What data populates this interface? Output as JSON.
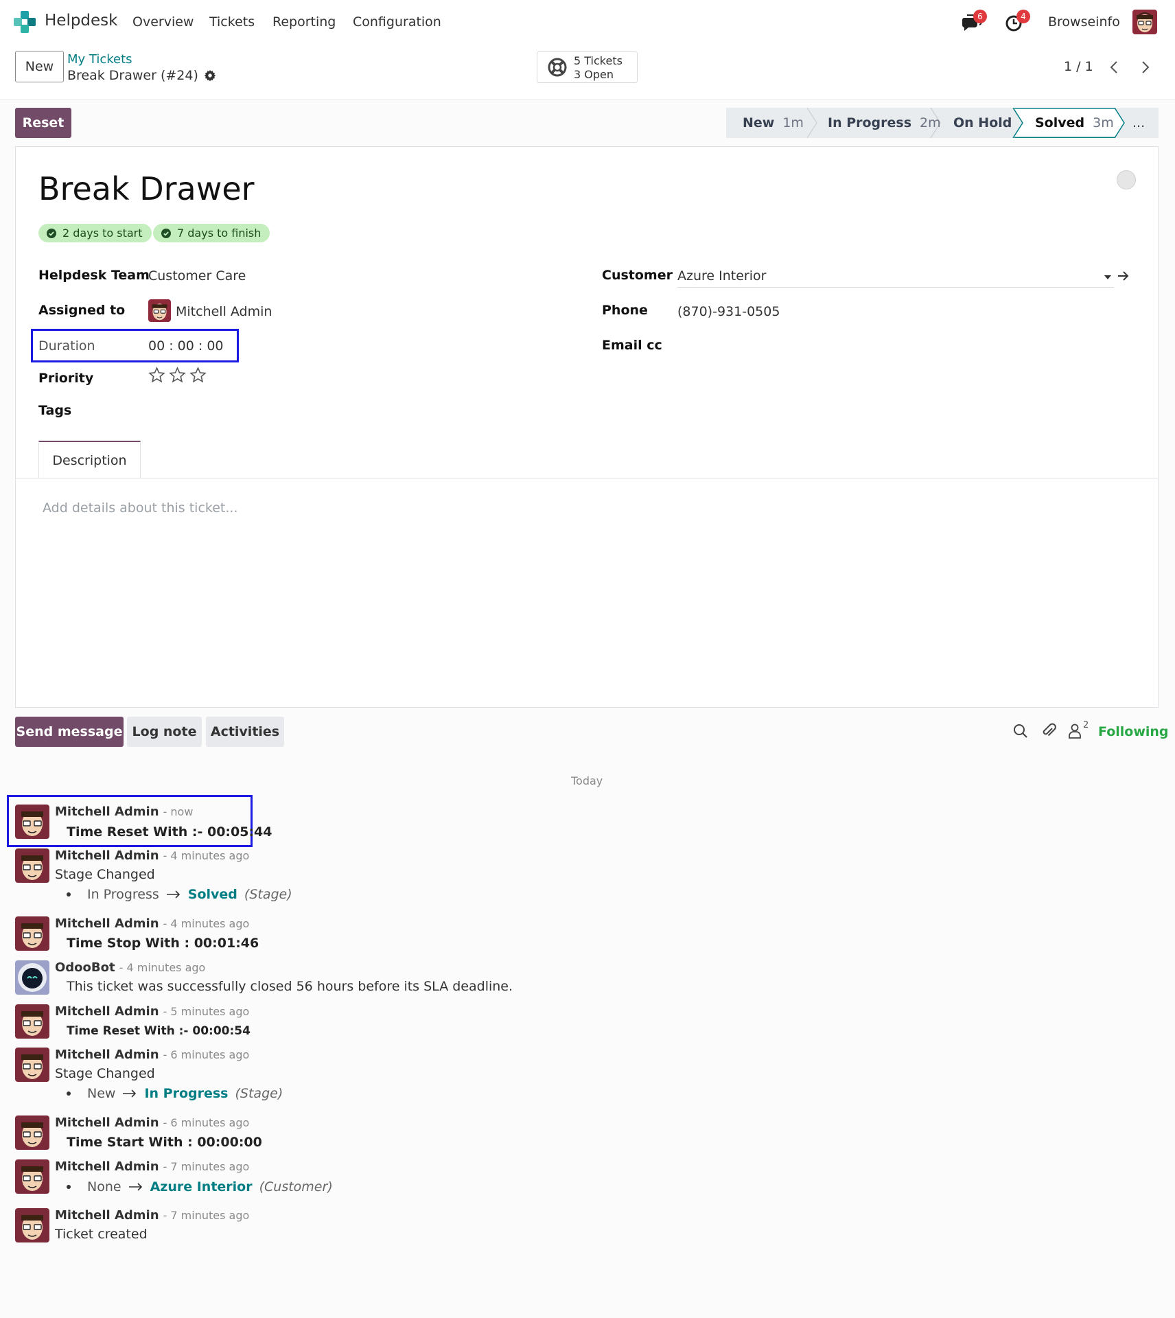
{
  "app": {
    "name": "Helpdesk",
    "menu": [
      "Overview",
      "Tickets",
      "Reporting",
      "Configuration"
    ],
    "messages_badge": "6",
    "activities_badge": "4",
    "company": "Browseinfo"
  },
  "control": {
    "new_button": "New",
    "breadcrumb_parent": "My Tickets",
    "breadcrumb_current": "Break Drawer (#24)",
    "tickets_count": "5 Tickets",
    "tickets_open": "3 Open",
    "pager": "1 / 1"
  },
  "actions": {
    "reset_button": "Reset",
    "stages": [
      {
        "name": "New",
        "time": "1m"
      },
      {
        "name": "In Progress",
        "time": "2m"
      },
      {
        "name": "On Hold",
        "time": ""
      },
      {
        "name": "Solved",
        "time": "3m"
      }
    ],
    "more": "..."
  },
  "form": {
    "title": "Break Drawer",
    "sla": [
      "2 days to start",
      "7 days to finish"
    ],
    "fields": {
      "team_label": "Helpdesk Team",
      "team_value": "Customer Care",
      "assigned_label": "Assigned to",
      "assigned_value": "Mitchell Admin",
      "duration_label": "Duration",
      "duration_value": "00 : 00 : 00",
      "priority_label": "Priority",
      "priority_value": 0,
      "priority_max": 3,
      "tags_label": "Tags",
      "customer_label": "Customer",
      "customer_value": "Azure Interior",
      "phone_label": "Phone",
      "phone_value": "(870)-931-0505",
      "email_cc_label": "Email cc"
    },
    "tab": "Description",
    "description_placeholder": "Add details about this ticket..."
  },
  "chatter": {
    "send_message": "Send message",
    "log_note": "Log note",
    "activities": "Activities",
    "followers_count": "2",
    "following": "Following",
    "date_separator": "Today",
    "messages": [
      {
        "author": "Mitchell Admin",
        "time": "- now",
        "bold": "Time Reset With :- 00:05:44"
      },
      {
        "author": "Mitchell Admin",
        "time": "- 4 minutes ago",
        "text": "Stage Changed",
        "old": "In Progress",
        "new": "Solved",
        "field": "(Stage)"
      },
      {
        "author": "Mitchell Admin",
        "time": "- 4 minutes ago",
        "bold": "Time Stop With : 00:01:46"
      },
      {
        "author": "OdooBot",
        "time": "- 4 minutes ago",
        "text": "This ticket was successfully closed 56 hours before its SLA deadline."
      },
      {
        "author": "Mitchell Admin",
        "time": "- 5 minutes ago",
        "bold": "Time Reset With :- 00:00:54"
      },
      {
        "author": "Mitchell Admin",
        "time": "- 6 minutes ago",
        "text": "Stage Changed",
        "old": "New",
        "new": "In Progress",
        "field": "(Stage)"
      },
      {
        "author": "Mitchell Admin",
        "time": "- 6 minutes ago",
        "bold": "Time Start With : 00:00:00"
      },
      {
        "author": "Mitchell Admin",
        "time": "- 7 minutes ago",
        "old": "None",
        "new": "Azure Interior",
        "field": "(Customer)"
      },
      {
        "author": "Mitchell Admin",
        "time": "- 7 minutes ago",
        "text": "Ticket created"
      }
    ]
  },
  "colors": {
    "brand": "#714b67",
    "link": "#017e84",
    "following": "#28a745",
    "badge": "#e0393e",
    "highlight": "#1a1ae0",
    "sla_tag": "#c5eebe"
  },
  "icons": [
    "helpdesk-logo-icon",
    "chat-icon",
    "clock-icon",
    "gear-icon",
    "lifebuoy-icon",
    "chevron-left-icon",
    "chevron-right-icon",
    "star-icon",
    "caret-down-icon",
    "arrow-right-icon",
    "search-icon",
    "paperclip-icon",
    "user-icon",
    "check-circle-icon"
  ]
}
